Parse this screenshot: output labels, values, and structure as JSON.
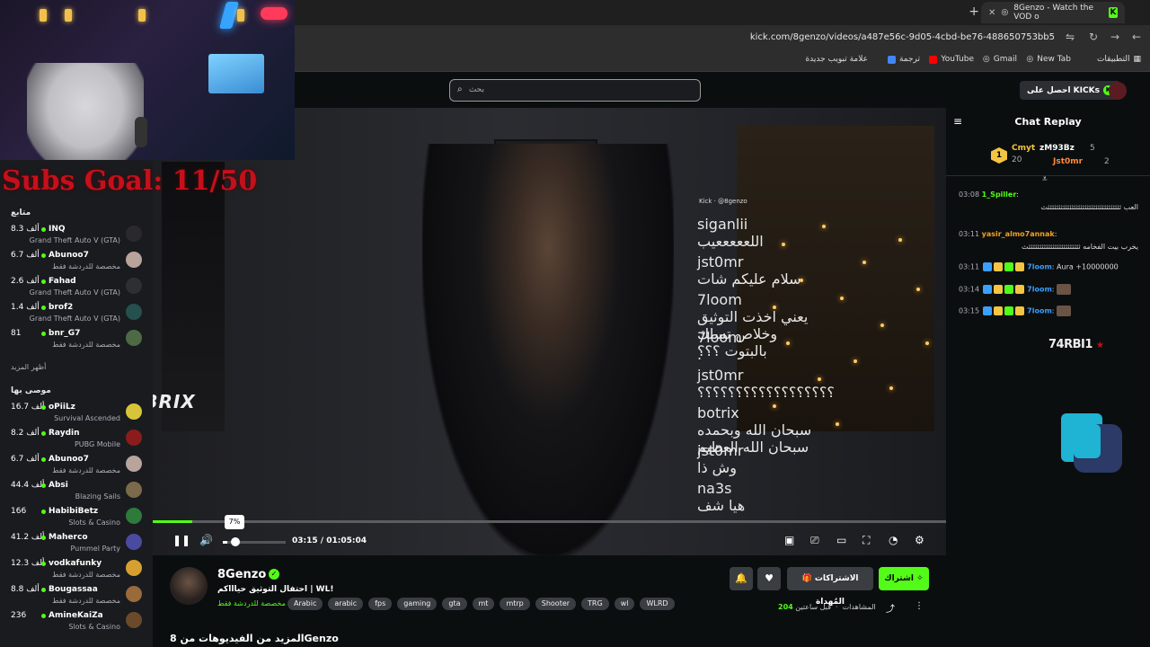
{
  "browser": {
    "tab_title": "8Genzo - Watch the VOD o",
    "url": "kick.com/8genzo/videos/a487e56c-9d05-4cbd-be76-488650753bb5",
    "bookmarks": [
      "التطبيقات",
      "New Tab",
      "Gmail",
      "YouTube",
      "ترجمة",
      "علامة تبويب جديدة"
    ]
  },
  "overlay": {
    "subs_goal": "Subs Goal: 11/50",
    "labrix": "LABRIX"
  },
  "header": {
    "search_placeholder": "بحث",
    "kicks_label": "احصل على KICKs"
  },
  "sidebar": {
    "following_title": "متابع",
    "following": [
      {
        "name": "INQ",
        "count": "8.3 ألف",
        "category": "Grand Theft Auto V (GTA)",
        "color": "#2a2a2e"
      },
      {
        "name": "Abunoo7",
        "count": "6.7 ألف",
        "category": "مخصصة للدردشة فقط",
        "color": "#b8a49a"
      },
      {
        "name": "Fahad",
        "count": "2.6 ألف",
        "category": "Grand Theft Auto V (GTA)",
        "color": "#2f2f33"
      },
      {
        "name": "brof2",
        "count": "1.4 ألف",
        "category": "Grand Theft Auto V (GTA)",
        "color": "#25504d"
      },
      {
        "name": "bnr_G7",
        "count": "81",
        "category": "مخصصة للدردشة فقط",
        "color": "#4d6a44"
      }
    ],
    "show_more": "أظهر المزيد",
    "recommended_title": "موصى بها",
    "recommended": [
      {
        "name": "oPiiLz",
        "count": "16.7 ألف",
        "category": "Survival Ascended",
        "color": "#d8c43a"
      },
      {
        "name": "Raydin",
        "count": "8.2 ألف",
        "category": "PUBG Mobile",
        "color": "#8a1c1c"
      },
      {
        "name": "Abunoo7",
        "count": "6.7 ألف",
        "category": "مخصصة للدردشة فقط",
        "color": "#b8a49a"
      },
      {
        "name": "Absi",
        "count": "44.4 ألف",
        "category": "Blazing Sails",
        "color": "#7a6a4a"
      },
      {
        "name": "HabibiBetz",
        "count": "166",
        "category": "Slots & Casino",
        "color": "#2d7a3a"
      },
      {
        "name": "Maherco",
        "count": "41.2 ألف",
        "category": "Pummel Party",
        "color": "#4a4aa0"
      },
      {
        "name": "vodkafunky",
        "count": "12.3 ألف",
        "category": "مخصصة للدردشة فقط",
        "color": "#d6a030"
      },
      {
        "name": "Bougassaa",
        "count": "8.8 ألف",
        "category": "مخصصة للدردشة فقط",
        "color": "#9a6a3a"
      },
      {
        "name": "AmineKaiZa",
        "count": "236",
        "category": "Slots & Casino",
        "color": "#6a4a2a"
      }
    ]
  },
  "video_chat": {
    "header": "Kick · @8genzo",
    "messages": [
      {
        "user": "siganlii",
        "text": "اللعععععيب"
      },
      {
        "user": "jst0mr",
        "text": "سلام عليكم شات"
      },
      {
        "user": "7loom",
        "text": "يعني اخذت التوثيق وخلاص تسلك بالبتوت ؟؟؟"
      },
      {
        "user": "7loom",
        "text": "."
      },
      {
        "user": "jst0mr",
        "text": "؟؟؟؟؟؟؟؟؟؟؟؟؟؟؟؟؟؟"
      },
      {
        "user": "botrix",
        "text": "سبحان الله وبحمده سبحان الله العظيم"
      },
      {
        "user": "jst0mr",
        "text": "وش ذا"
      },
      {
        "user": "na3s",
        "text": "هيا شف"
      }
    ]
  },
  "player": {
    "time": "03:15 / 01:05:04",
    "progress": 0.05,
    "volume_label": "7%",
    "volume": 0.07
  },
  "stream": {
    "channel": "8Genzo",
    "title": "احتفال التوثيق حياااكم | WL!",
    "category": "مخصصة للدردشة فقط",
    "tags": [
      "Arabic",
      "arabic",
      "fps",
      "gaming",
      "gta",
      "mt",
      "mtrp",
      "Shooter",
      "TRG",
      "wl",
      "WLRD"
    ],
    "subscribe": "اشتراك",
    "gift_subs": "الاشتراكات المُهداة",
    "views_label": "المشاهدات",
    "views_count": "204",
    "time_ago": "قبل ساعتين",
    "more_videos": "المزيد من الفيديوهات من 8Genzo"
  },
  "chat": {
    "title": "Chat Replay",
    "leaders": [
      {
        "name": "zM93Bz",
        "value": "5"
      },
      {
        "name": "Jst0mr",
        "value": "2"
      },
      {
        "name": "Cmyt",
        "value": "20"
      }
    ],
    "messages": [
      {
        "time": "03:08",
        "user": "1_Spiller",
        "text": "العب ثثثثثثثثثثثثثثثثثثثثثثثثثثثثثثثثثثث"
      },
      {
        "time": "03:11",
        "user": "yasir_almo7annak",
        "text": "يخرب بيت الفخامه ثثثثثثثثثثثثثثثثثثثثثثثثث"
      },
      {
        "time": "03:11",
        "user": "7loom",
        "text": "Aura +10000000"
      },
      {
        "time": "03:14",
        "user": "7loom",
        "text": ""
      },
      {
        "time": "03:15",
        "user": "7loom",
        "text": ""
      }
    ],
    "brand": "74RBI1"
  }
}
